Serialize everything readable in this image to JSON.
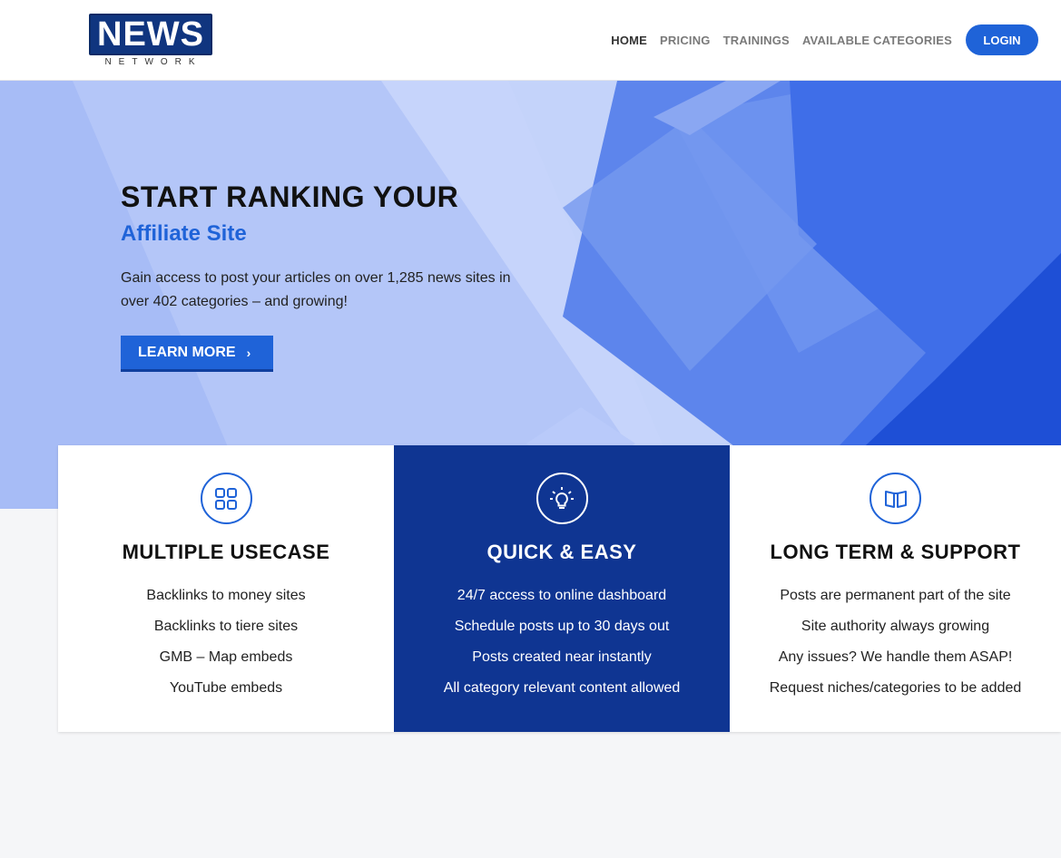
{
  "brand": {
    "logo_main": "NEWS",
    "logo_sub": "NETWORK"
  },
  "nav": {
    "items": [
      {
        "label": "HOME",
        "active": true
      },
      {
        "label": "PRICING",
        "active": false
      },
      {
        "label": "TRAININGS",
        "active": false
      },
      {
        "label": "AVAILABLE CATEGORIES",
        "active": false
      }
    ],
    "login_label": "LOGIN"
  },
  "hero": {
    "title": "START RANKING YOUR",
    "subtitle": "Affiliate Site",
    "description": "Gain access to post your articles on over 1,285 news sites in over 402 categories – and growing!",
    "button_label": "LEARN MORE"
  },
  "features": [
    {
      "icon": "grid-icon",
      "title": "MULTIPLE USECASE",
      "items": [
        "Backlinks to money sites",
        "Backlinks to tiere sites",
        "GMB – Map embeds",
        "YouTube embeds"
      ]
    },
    {
      "icon": "lightbulb-icon",
      "title": "QUICK & EASY",
      "items": [
        "24/7 access to online dashboard",
        "Schedule posts up to 30 days out",
        "Posts created near instantly",
        "All category relevant content allowed"
      ]
    },
    {
      "icon": "book-icon",
      "title": "LONG TERM & SUPPORT",
      "items": [
        "Posts are permanent part of the site",
        "Site authority always growing",
        "Any issues? We handle them ASAP!",
        "Request niches/categories to be added"
      ]
    }
  ],
  "colors": {
    "accent": "#1f63d8",
    "dark_blue": "#0f3592",
    "logo_blue": "#10357f"
  }
}
